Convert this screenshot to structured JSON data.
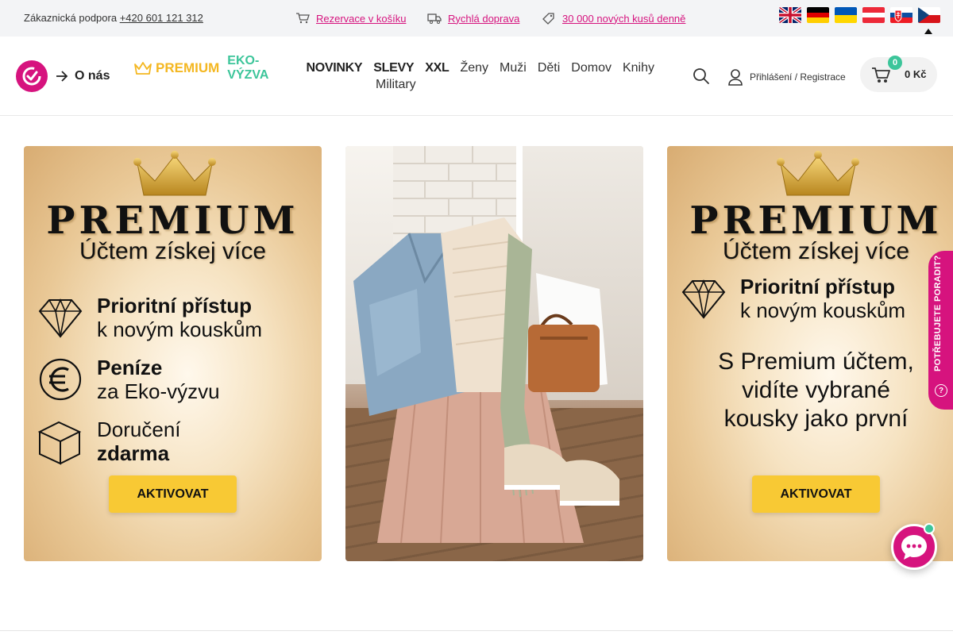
{
  "topbar": {
    "support_label": "Zákaznická podpora",
    "support_phone": "+420 601 121 312",
    "links": [
      {
        "label": "Rezervace v košíku",
        "icon": "cart-icon"
      },
      {
        "label": "Rychlá doprava",
        "icon": "truck-icon"
      },
      {
        "label": "30 000 nových kusů denně",
        "icon": "tag-icon"
      }
    ],
    "flags": [
      "gb-flag",
      "de-flag",
      "ua-flag",
      "at-flag",
      "sk-flag",
      "cz-flag"
    ]
  },
  "header": {
    "about_label": "O nás",
    "nav": {
      "premium": "PREMIUM",
      "eko": "EKO-VÝZVA",
      "novinky": "NOVINKY",
      "slevy": "SLEVY",
      "xxl": "XXL",
      "zeny": "Ženy",
      "muzi": "Muži",
      "deti": "Děti",
      "domov": "Domov",
      "knihy": "Knihy",
      "military": "Military"
    },
    "login_label": "Přihlášení / Registrace",
    "cart_count": "0",
    "cart_price": "0 Kč"
  },
  "banner_left": {
    "title": "PREMIUM",
    "subtitle": "Účtem získej více",
    "feature1_line1": "Prioritní přístup",
    "feature1_line2": "k novým kouskům",
    "feature2_line1": "Peníze",
    "feature2_line2": "za Eko-výzvu",
    "feature3_line1": "Doručení",
    "feature3_line2": "zdarma",
    "button": "AKTIVOVAT"
  },
  "banner_right": {
    "title": "PREMIUM",
    "subtitle": "Účtem získej více",
    "feature1_line1": "Prioritní přístup",
    "feature1_line2": "k novým kouskům",
    "message_line1": "S Premium účtem,",
    "message_line2": "vidíte vybrané",
    "message_line3": "kousky jako první",
    "button": "AKTIVOVAT"
  },
  "side_widget": {
    "label": "POTŘEBUJETE PORADIT?",
    "q": "?"
  },
  "colors": {
    "brand": "#d6137e",
    "eko": "#3cc59a",
    "premium": "#f4b721",
    "button": "#f8c934"
  }
}
